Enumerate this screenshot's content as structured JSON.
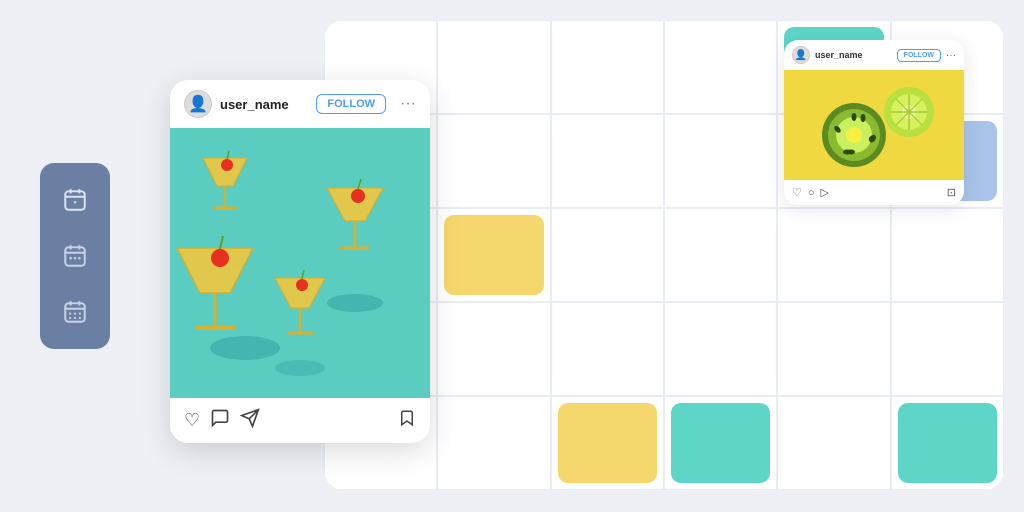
{
  "sidebar": {
    "icons": [
      {
        "name": "calendar-single-icon",
        "label": "calendar single"
      },
      {
        "name": "calendar-multi-icon",
        "label": "calendar multi"
      },
      {
        "name": "calendar-grid-icon",
        "label": "calendar grid"
      }
    ],
    "bg_color": "#6b7fa3"
  },
  "insta_card_large": {
    "username": "user_name",
    "follow_label": "FOLLOW",
    "dots_label": "···",
    "image_alt": "cocktail martini glasses on teal background",
    "heart_icon": "♡",
    "comment_icon": "○",
    "share_icon": "▷",
    "bookmark_icon": "⊡"
  },
  "insta_card_small": {
    "username": "user_name",
    "follow_label": "FOLLOW",
    "dots_label": "···",
    "image_alt": "kiwi and lime on yellow background",
    "heart_icon": "♡",
    "comment_icon": "○",
    "share_icon": "▷",
    "bookmark_icon": "⊡"
  },
  "grid_accents": {
    "teal_color": "#5dd6c8",
    "yellow_color": "#f5d76e",
    "blue_color": "#a8c4e8"
  }
}
